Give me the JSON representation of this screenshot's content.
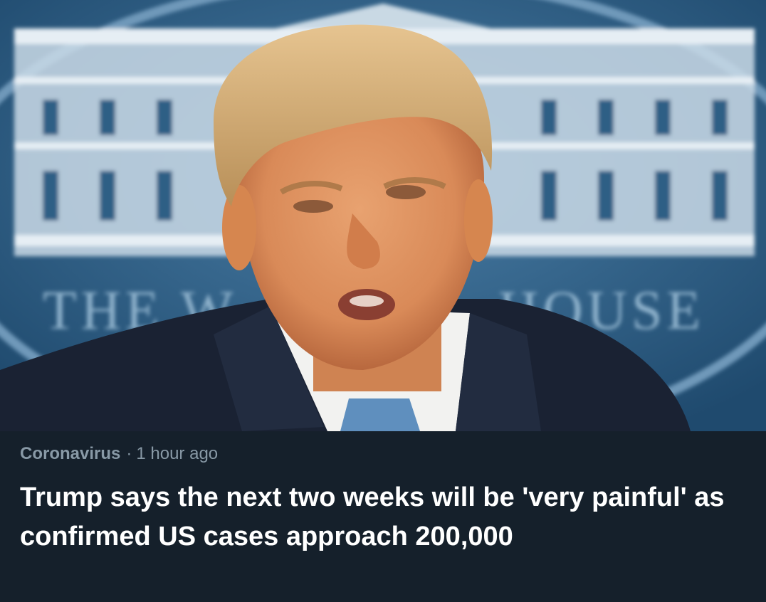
{
  "card": {
    "image": {
      "subject": "man-speaking-at-podium",
      "backdrop_text": "THE WHITE HOUSE",
      "visible_backdrop_left": "THE W",
      "visible_backdrop_right": "HOUSE"
    },
    "meta": {
      "category": "Coronavirus",
      "separator": "·",
      "time": "1 hour ago"
    },
    "headline": "Trump says the next two weeks will be 'very painful' as confirmed US cases approach 200,000"
  },
  "colors": {
    "card_background": "#15202b",
    "meta_text": "#8899a6",
    "headline_text": "#ffffff",
    "backdrop_blue": "#2f5f86"
  }
}
